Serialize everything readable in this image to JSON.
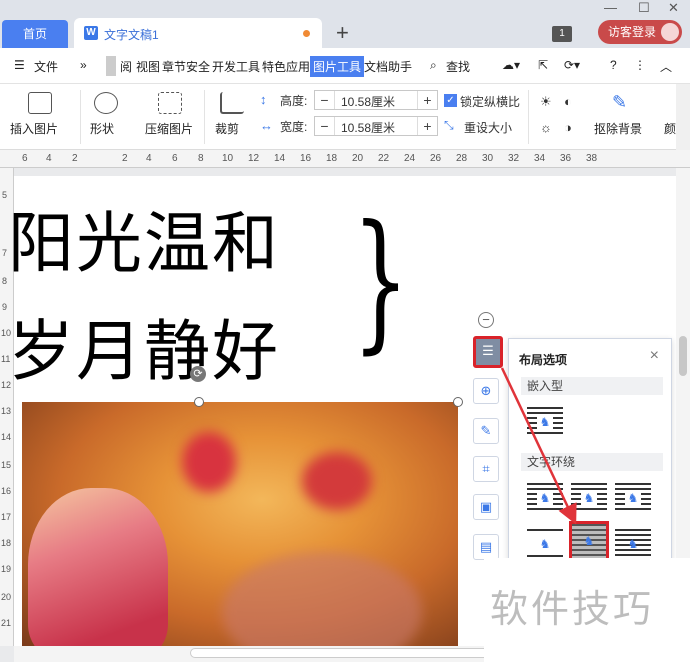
{
  "titlebar": {
    "home_tab": "首页",
    "doc_tab": "文字文稿1",
    "add_tab": "+",
    "badge": "1",
    "login": "访客登录"
  },
  "menubar": {
    "file": "文件",
    "more": "»",
    "items": [
      "阅",
      "视图",
      "章节",
      "安全",
      "开发工具",
      "特色应用",
      "图片工具",
      "文档助手"
    ],
    "active": "图片工具",
    "search": "查找"
  },
  "ribbon": {
    "insert_picture": "插入图片",
    "shape": "形状",
    "compress": "压缩图片",
    "crop": "裁剪",
    "height_label": "高度:",
    "height_value": "10.58厘米",
    "width_label": "宽度:",
    "width_value": "10.58厘米",
    "lock_ratio": "锁定纵横比",
    "reset_size": "重设大小",
    "remove_bg": "抠除背景",
    "color_partial": "颜"
  },
  "hruler_ticks": [
    "6",
    "4",
    "2",
    "2",
    "4",
    "6",
    "8",
    "10",
    "12",
    "14",
    "16",
    "18",
    "20",
    "22",
    "24",
    "26",
    "28",
    "30",
    "32",
    "34",
    "36",
    "38"
  ],
  "vruler_ticks": [
    "5",
    "7",
    "8",
    "9",
    "10",
    "11",
    "12",
    "13",
    "14",
    "15",
    "16",
    "17",
    "18",
    "19",
    "20",
    "21"
  ],
  "document": {
    "line1": "阳光温和",
    "line2": "岁月静好",
    "brace": "}"
  },
  "layout_panel": {
    "title": "布局选项",
    "close": "×",
    "inline_section": "嵌入型",
    "wrap_section": "文字环绕"
  },
  "watermark": "软件技巧",
  "colors": {
    "accent": "#4a7ff0",
    "highlight_red": "#d9232a",
    "login_bg": "#c94a4a"
  }
}
